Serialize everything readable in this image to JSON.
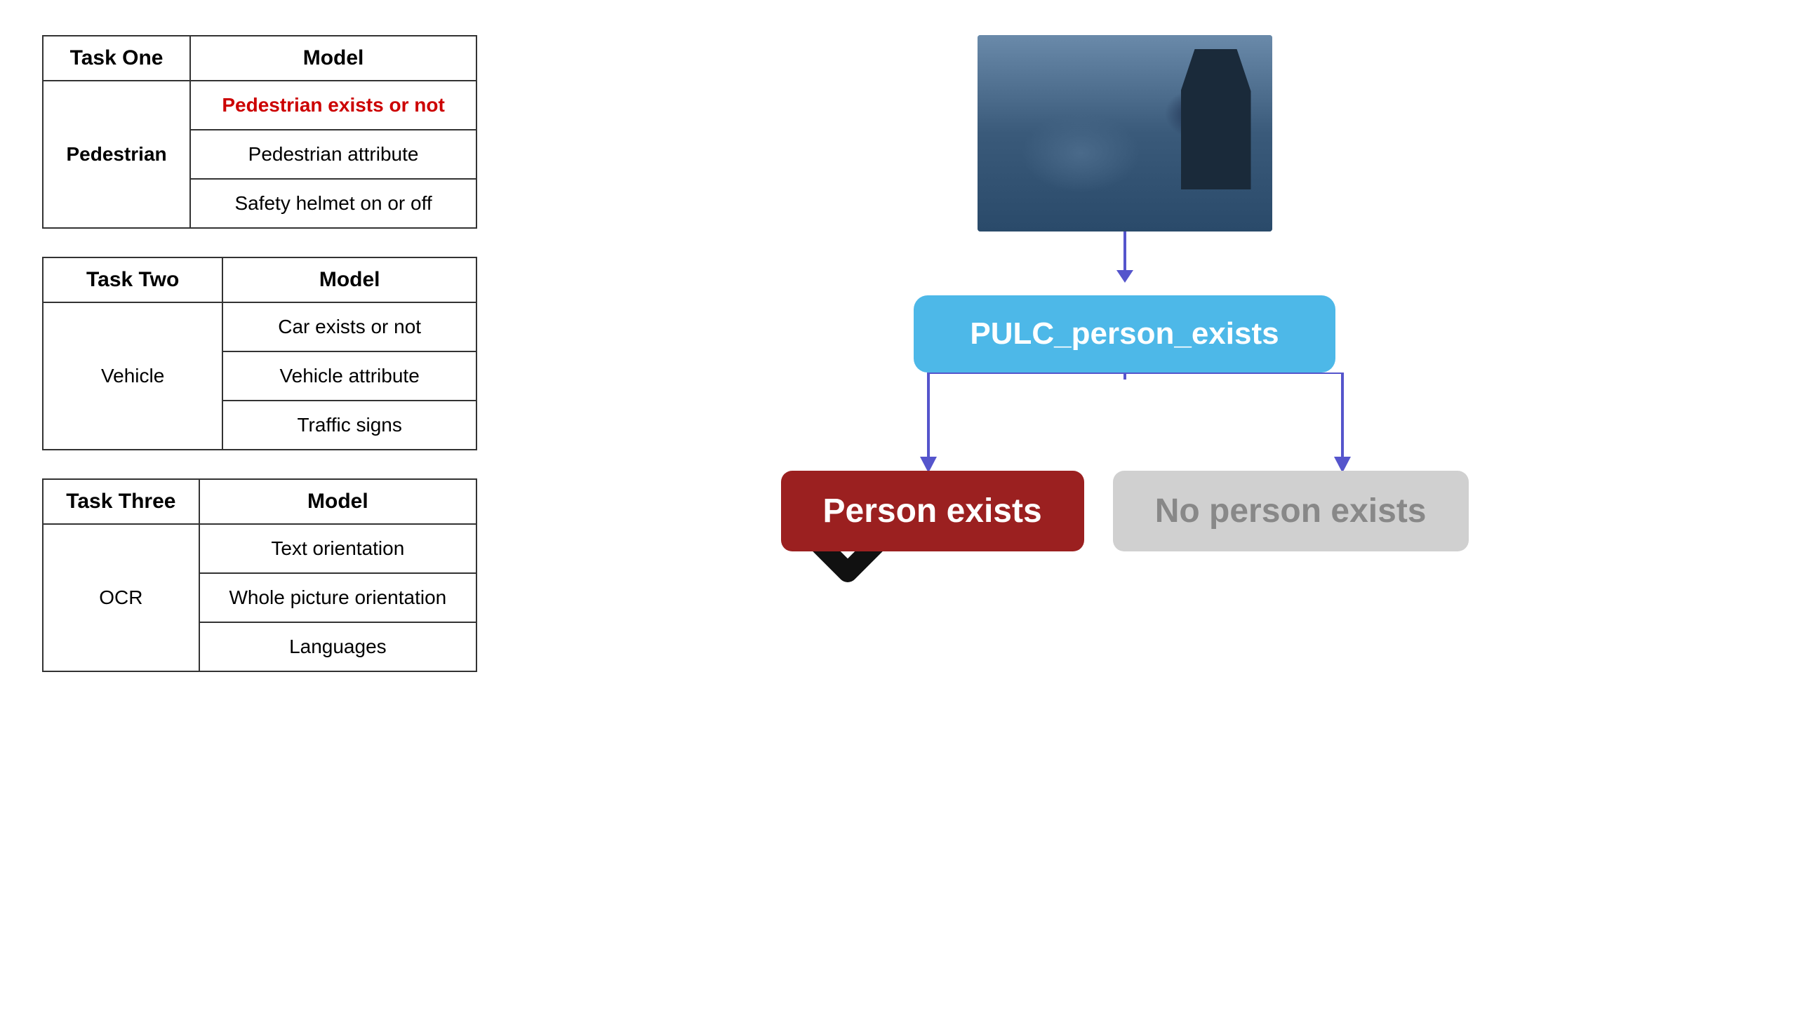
{
  "tables": {
    "task_one": {
      "task_label": "Task One",
      "model_label": "Model",
      "row_label": "Pedestrian",
      "models": [
        {
          "text": "Pedestrian exists or not",
          "highlighted": true
        },
        {
          "text": "Pedestrian attribute",
          "highlighted": false
        },
        {
          "text": "Safety helmet on or off",
          "highlighted": false
        }
      ]
    },
    "task_two": {
      "task_label": "Task Two",
      "model_label": "Model",
      "row_label": "Vehicle",
      "models": [
        {
          "text": "Car exists or not",
          "highlighted": false
        },
        {
          "text": "Vehicle attribute",
          "highlighted": false
        },
        {
          "text": "Traffic signs",
          "highlighted": false
        }
      ]
    },
    "task_three": {
      "task_label": "Task Three",
      "model_label": "Model",
      "row_label": "OCR",
      "models": [
        {
          "text": "Text orientation",
          "highlighted": false
        },
        {
          "text": "Whole picture orientation",
          "highlighted": false
        },
        {
          "text": "Languages",
          "highlighted": false
        }
      ]
    }
  },
  "diagram": {
    "pulc_label": "PULC_person_exists",
    "person_exists_label": "Person exists",
    "no_person_label": "No person exists",
    "checkmark": "✔",
    "arrow_color": "#5555cc",
    "person_box_color": "#9b2020",
    "no_person_box_color": "#d0d0d0",
    "pulc_box_color": "#4db8e8"
  }
}
